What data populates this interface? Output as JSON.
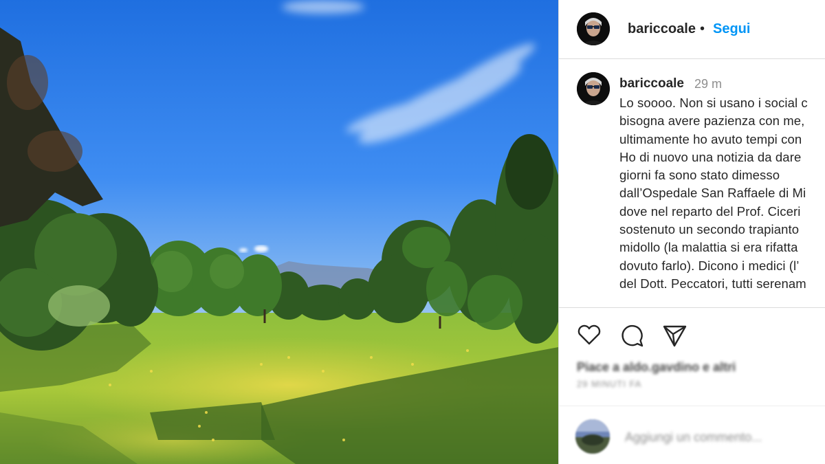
{
  "post": {
    "username": "bariccoale",
    "separator": "•",
    "follow_label": "Segui",
    "photo_icon": "park-landscape-photo"
  },
  "caption": {
    "username": "bariccoale",
    "time": "29 m",
    "lines": [
      "Lo soooo. Non si usano i social c",
      "bisogna avere pazienza con me,",
      "ultimamente ho avuto tempi con",
      "Ho di nuovo una notizia da dare",
      "giorni fa sono stato dimesso",
      "dall’Ospedale San Raffaele di Mi",
      "dove nel reparto del Prof. Ciceri",
      "sostenuto un secondo trapianto",
      "midollo (la malattia si era rifatta",
      "dovuto farlo). Dicono i medici (l’",
      "del Dott. Peccatori, tutti serenam"
    ]
  },
  "actions": {
    "like_icon": "heart-icon",
    "comment_icon": "comment-bubble-icon",
    "share_icon": "paper-plane-icon"
  },
  "likes_text": "Piace a aldo.gavdino e altri",
  "date_text": "29 MINUTI FA",
  "comment": {
    "placeholder": "Aggiungi un commento..."
  },
  "colors": {
    "link": "#0095f6",
    "text": "#262626",
    "muted": "#8e8e8e",
    "border": "#dbdbdb"
  }
}
